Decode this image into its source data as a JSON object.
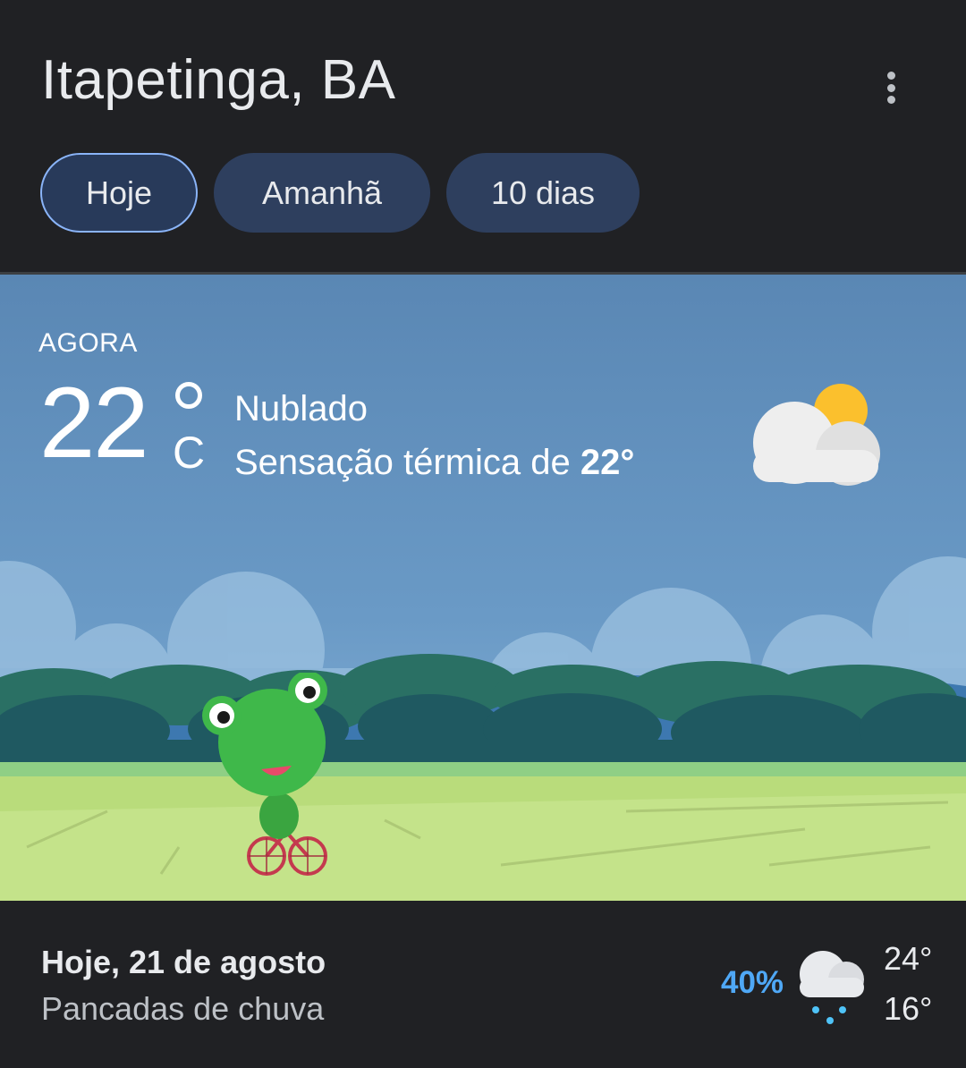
{
  "header": {
    "location": "Itapetinga, BA",
    "menu_icon": "more-vert-icon",
    "tabs": [
      {
        "label": "Hoje",
        "active": true
      },
      {
        "label": "Amanhã",
        "active": false
      },
      {
        "label": "10 dias",
        "active": false
      }
    ]
  },
  "current": {
    "label": "AGORA",
    "temperature": "22",
    "unit": "C",
    "condition": "Nublado",
    "feels_like_prefix": "Sensação térmica de",
    "feels_like_value": "22°",
    "icon": "partly-cloudy-icon"
  },
  "forecast_today": {
    "day": "Hoje, 21 de agosto",
    "description": "Pancadas de chuva",
    "precipitation": "40%",
    "icon": "rain-showers-icon",
    "high": "24°",
    "low": "16°"
  },
  "colors": {
    "background": "#202124",
    "sky": "#5e8fbe",
    "tab_fill": "#2e3f5e",
    "tab_active_border": "#8ab4f8",
    "precip_blue": "#4fa8f6"
  }
}
